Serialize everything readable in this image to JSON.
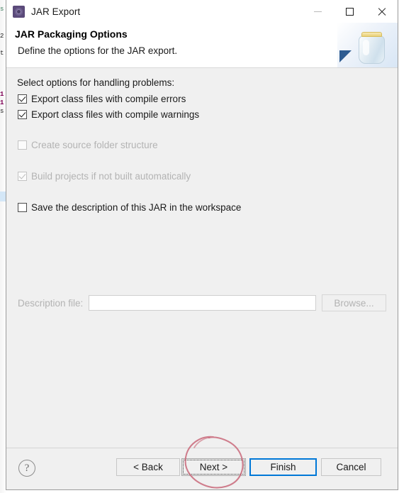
{
  "window": {
    "title": "JAR Export",
    "icon": "jar-export-icon",
    "controls": {
      "minimize": "minimize-icon",
      "maximize": "maximize-icon",
      "close": "close-icon"
    }
  },
  "header": {
    "title": "JAR Packaging Options",
    "subtitle": "Define the options for the JAR export.",
    "banner_icon": "jar-jar-graphic"
  },
  "content": {
    "section_label": "Select options for handling problems:",
    "options": [
      {
        "label": "Export class files with compile errors",
        "checked": true,
        "disabled": false
      },
      {
        "label": "Export class files with compile warnings",
        "checked": true,
        "disabled": false
      },
      {
        "label": "Create source folder structure",
        "checked": false,
        "disabled": true
      },
      {
        "label": "Build projects if not built automatically",
        "checked": true,
        "disabled": true
      },
      {
        "label": "Save the description of this JAR in the workspace",
        "checked": false,
        "disabled": false
      }
    ],
    "description_file": {
      "label": "Description file:",
      "value": "",
      "placeholder": "",
      "disabled": true,
      "browse_label": "Browse..."
    }
  },
  "buttons": {
    "help": "?",
    "back": "< Back",
    "next": "Next >",
    "finish": "Finish",
    "cancel": "Cancel"
  },
  "annotation": {
    "shape": "hand-drawn-ellipse",
    "target": "Next >",
    "color": "#c9697a"
  },
  "colors": {
    "default_button_border": "#0078d7",
    "dialog_background": "#f0f0f0",
    "header_background": "#ffffff",
    "disabled_text": "#b3b3b3"
  },
  "background_editor": {
    "fragments": [
      "s",
      "2",
      "t",
      "1",
      "1",
      "s"
    ]
  }
}
